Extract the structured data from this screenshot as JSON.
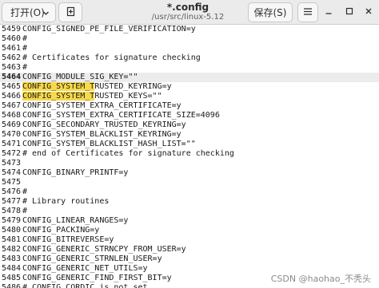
{
  "header": {
    "open_label": "打开(O)",
    "title": "*.config",
    "path": "/usr/src/linux-5.12",
    "save_label": "保存(S)",
    "open_icon": "chevron-down-icon",
    "newtab_icon": "new-document-icon",
    "menu_icon": "hamburger-menu-icon",
    "minimize_icon": "minimize-icon",
    "maximize_icon": "maximize-icon",
    "close_icon": "close-icon"
  },
  "editor": {
    "current_line": "5464",
    "lines": [
      {
        "num": "5459",
        "text": "CONFIG_SIGNED_PE_FILE_VERIFICATION=y",
        "hl": "",
        "rest": ""
      },
      {
        "num": "5460",
        "text": "#",
        "hl": "",
        "rest": ""
      },
      {
        "num": "5461",
        "text": "#",
        "hl": "",
        "rest": ""
      },
      {
        "num": "5462",
        "text": "# Certificates for signature checking",
        "hl": "",
        "rest": ""
      },
      {
        "num": "5463",
        "text": "#",
        "hl": "",
        "rest": ""
      },
      {
        "num": "5464",
        "text": "CONFIG_MODULE_SIG_KEY=\"\"",
        "hl": "",
        "rest": ""
      },
      {
        "num": "5465",
        "text": "",
        "hl": "CONFIG_SYSTEM_T",
        "rest": "RUSTED_KEYRING=y"
      },
      {
        "num": "5466",
        "text": "",
        "hl": "CONFIG_SYSTEM_T",
        "rest": "RUSTED_KEYS=\"\""
      },
      {
        "num": "5467",
        "text": "CONFIG_SYSTEM_EXTRA_CERTIFICATE=y",
        "hl": "",
        "rest": ""
      },
      {
        "num": "5468",
        "text": "CONFIG_SYSTEM_EXTRA_CERTIFICATE_SIZE=4096",
        "hl": "",
        "rest": ""
      },
      {
        "num": "5469",
        "text": "CONFIG_SECONDARY_TRUSTED_KEYRING=y",
        "hl": "",
        "rest": ""
      },
      {
        "num": "5470",
        "text": "CONFIG_SYSTEM_BLACKLIST_KEYRING=y",
        "hl": "",
        "rest": ""
      },
      {
        "num": "5471",
        "text": "CONFIG_SYSTEM_BLACKLIST_HASH_LIST=\"\"",
        "hl": "",
        "rest": ""
      },
      {
        "num": "5472",
        "text": "# end of Certificates for signature checking",
        "hl": "",
        "rest": ""
      },
      {
        "num": "5473",
        "text": "",
        "hl": "",
        "rest": ""
      },
      {
        "num": "5474",
        "text": "CONFIG_BINARY_PRINTF=y",
        "hl": "",
        "rest": ""
      },
      {
        "num": "5475",
        "text": "",
        "hl": "",
        "rest": ""
      },
      {
        "num": "5476",
        "text": "#",
        "hl": "",
        "rest": ""
      },
      {
        "num": "5477",
        "text": "# Library routines",
        "hl": "",
        "rest": ""
      },
      {
        "num": "5478",
        "text": "#",
        "hl": "",
        "rest": ""
      },
      {
        "num": "5479",
        "text": "CONFIG_LINEAR_RANGES=y",
        "hl": "",
        "rest": ""
      },
      {
        "num": "5480",
        "text": "CONFIG_PACKING=y",
        "hl": "",
        "rest": ""
      },
      {
        "num": "5481",
        "text": "CONFIG_BITREVERSE=y",
        "hl": "",
        "rest": ""
      },
      {
        "num": "5482",
        "text": "CONFIG_GENERIC_STRNCPY_FROM_USER=y",
        "hl": "",
        "rest": ""
      },
      {
        "num": "5483",
        "text": "CONFIG_GENERIC_STRNLEN_USER=y",
        "hl": "",
        "rest": ""
      },
      {
        "num": "5484",
        "text": "CONFIG_GENERIC_NET_UTILS=y",
        "hl": "",
        "rest": ""
      },
      {
        "num": "5485",
        "text": "CONFIG_GENERIC_FIND_FIRST_BIT=y",
        "hl": "",
        "rest": ""
      },
      {
        "num": "5486",
        "text": "# CONFIG_CORDIC is not set",
        "hl": "",
        "rest": ""
      }
    ]
  },
  "watermark": "CSDN @haohao_不秃头",
  "colors": {
    "search_highlight": "#f7d94c",
    "current_line_bg": "#ececec",
    "header_bg": "#ebebeb"
  }
}
